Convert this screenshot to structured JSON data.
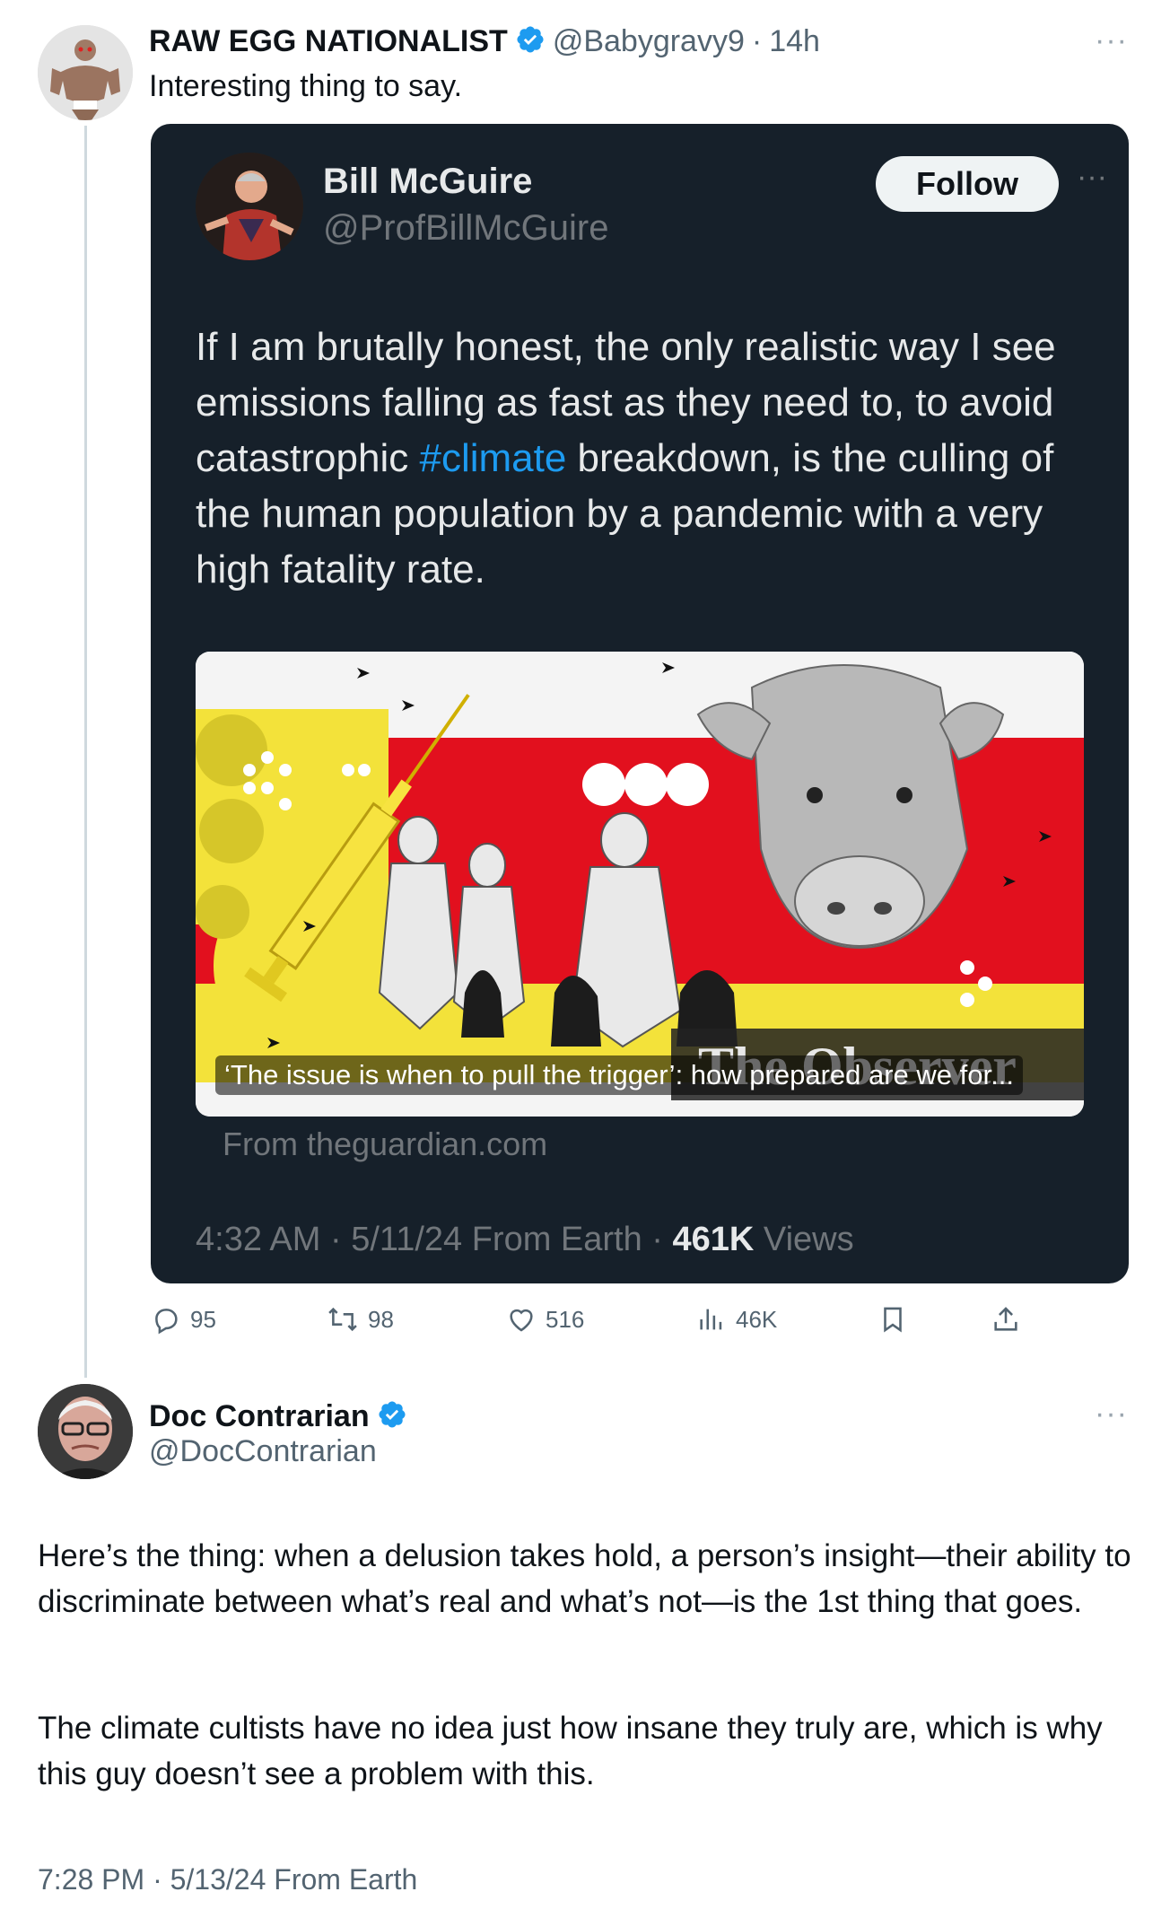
{
  "tweet": {
    "author_name": "RAW EGG NATIONALIST",
    "author_handle": "@Babygravy9",
    "separator": "·",
    "time": "14h",
    "more": "···",
    "text": "Interesting thing to say."
  },
  "quote": {
    "author_name": "Bill McGuire",
    "author_handle": "@ProfBillMcGuire",
    "follow_label": "Follow",
    "more": "···",
    "text_before": "If I am brutally honest, the only realistic way I see emissions falling as fast as they need to, to avoid catastrophic ",
    "hashtag": "#climate",
    "text_after": " breakdown, is the culling of the human population by a pandemic with a very high fatality rate.",
    "media_caption": "‘The issue is when to pull the trigger’: how prepared are we for...",
    "media_brand": "The Observer",
    "source": "From theguardian.com",
    "timestamp": "4:32 AM · 5/11/24 From Earth · ",
    "views_count": "461K",
    "views_label": " Views"
  },
  "actions": {
    "replies": "95",
    "reposts": "98",
    "likes": "516",
    "views": "46K",
    "reply_icon": "reply-icon",
    "repost_icon": "repost-icon",
    "like_icon": "heart-icon",
    "views_icon": "views-icon",
    "bookmark_icon": "bookmark-icon",
    "share_icon": "share-icon"
  },
  "reply": {
    "author_name": "Doc Contrarian",
    "author_handle": "@DocContrarian",
    "more": "···",
    "paragraph1": "Here’s the thing: when a delusion takes hold, a person’s insight—their ability to discriminate between what’s real and what’s not—is the 1st thing that goes.",
    "paragraph2": "The climate cultists have no idea just how insane they truly are, which is why this guy doesn’t see a problem with this.",
    "timestamp": "7:28 PM · 5/13/24 From Earth"
  },
  "colors": {
    "verified": "#1d9bf0",
    "card_bg": "#16202a",
    "hashtag": "#1d9bf0",
    "thread_line": "#cfd9de"
  }
}
